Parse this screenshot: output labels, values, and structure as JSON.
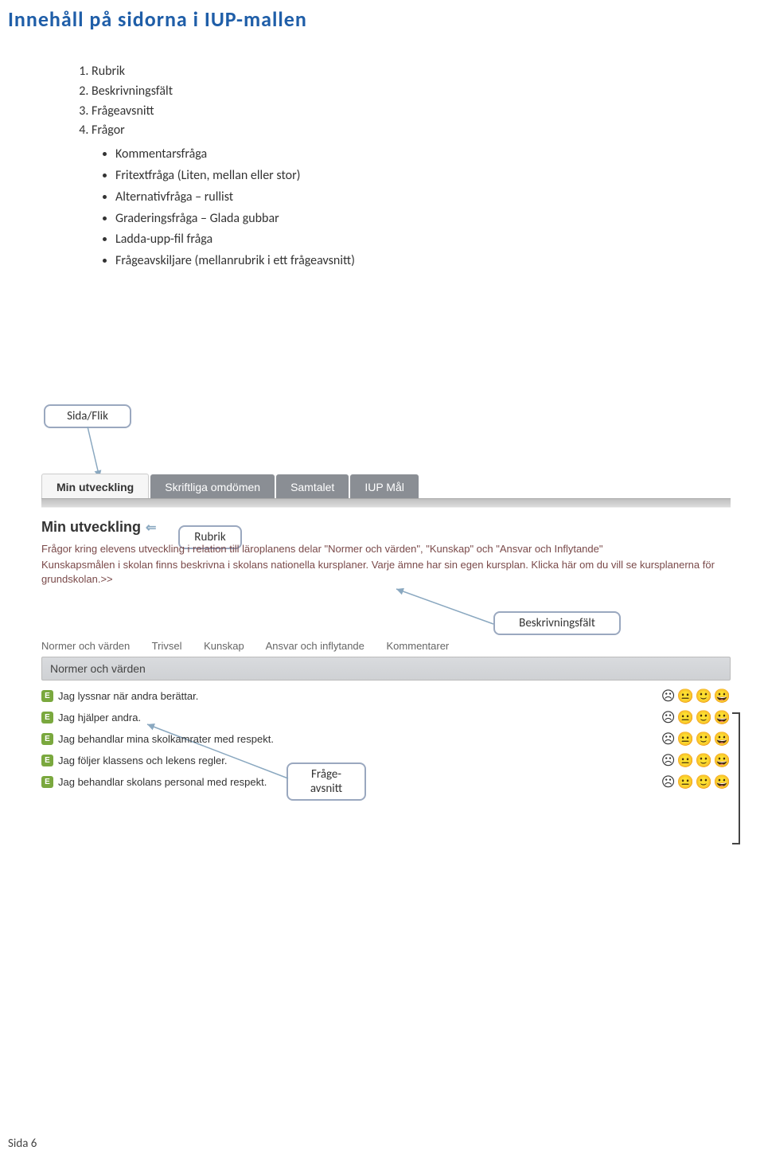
{
  "page_title": "Innehåll på sidorna i IUP-mallen",
  "list": {
    "i1": "Rubrik",
    "i2": "Beskrivningsfält",
    "i3": "Frågeavsnitt",
    "i4": "Frågor",
    "sub": {
      "a": "Kommentarsfråga",
      "b": "Fritextfråga (Liten, mellan eller stor)",
      "c": "Alternativfråga – rullist",
      "d": "Graderingsfråga – Glada gubbar",
      "e": "Ladda-upp-fil fråga",
      "f": "Frågeavskiljare (mellanrubrik i ett frågeavsnitt)"
    }
  },
  "callouts": {
    "sida_flik": "Sida/Flik",
    "rubrik": "Rubrik",
    "beskrivningsfalt": "Beskrivningsfält",
    "frageavsnitt_l1": "Fråge-",
    "frageavsnitt_l2": "avsnitt"
  },
  "tabs": {
    "t0": "Min utveckling",
    "t1": "Skriftliga omdömen",
    "t2": "Samtalet",
    "t3": "IUP Mål"
  },
  "section_heading": "Min utveckling",
  "desc": {
    "p1": "Frågor kring elevens utveckling i relation till läroplanens delar \"Normer och värden\", \"Kunskap\" och \"Ansvar och Inflytande\"",
    "p2": "Kunskapsmålen i skolan finns beskrivna i skolans nationella kursplaner. Varje ämne har sin egen kursplan. Klicka här om du vill se kursplanerna för grundskolan.>>"
  },
  "subtabs": {
    "s0": "Normer och värden",
    "s1": "Trivsel",
    "s2": "Kunskap",
    "s3": "Ansvar och inflytande",
    "s4": "Kommentarer"
  },
  "section_bar": "Normer och värden",
  "questions": [
    "Jag lyssnar när andra berättar.",
    "Jag hjälper andra.",
    "Jag behandlar mina skolkamrater med respekt.",
    "Jag följer klassens och lekens regler.",
    "Jag behandlar skolans personal med respekt."
  ],
  "footer": "Sida 6"
}
